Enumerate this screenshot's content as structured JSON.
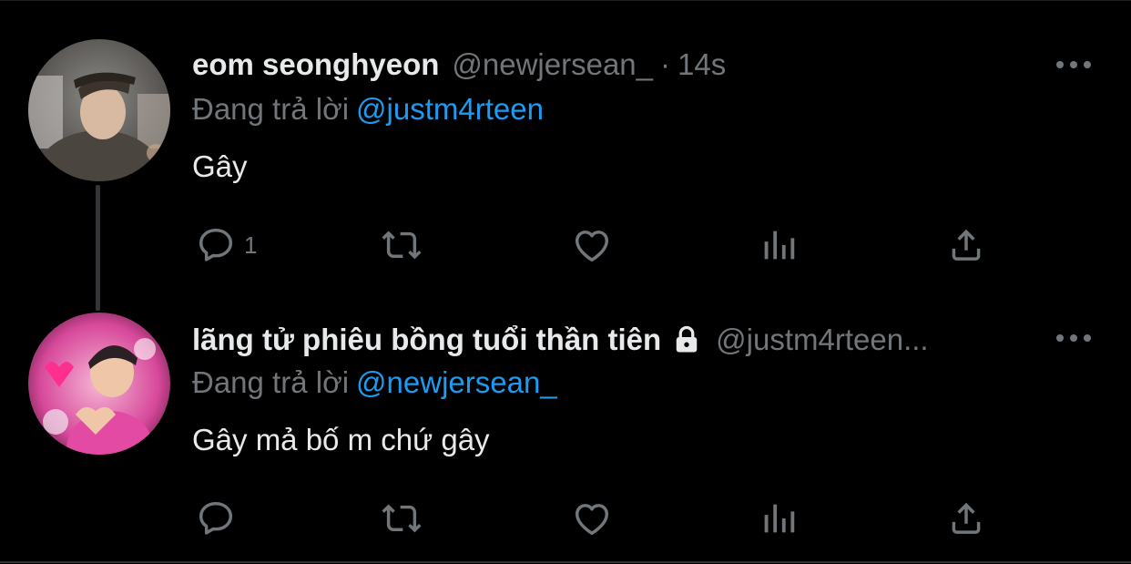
{
  "tweets": [
    {
      "display_name": "eom seonghyeon",
      "handle": "@newjersean_",
      "separator": "·",
      "time": "14s",
      "replying_label": "Đang trả lời",
      "replying_to": "@justm4rteen",
      "text": "Gây",
      "actions": {
        "reply_count": "1",
        "retweet_count": "",
        "like_count": ""
      }
    },
    {
      "display_name": "lãng tử phiêu bồng tuổi thần tiên",
      "protected": true,
      "handle": "@justm4rteen...",
      "replying_label": "Đang trả lời",
      "replying_to": "@newjersean_",
      "text": "Gây mả bố m chứ gây",
      "actions": {
        "reply_count": "",
        "retweet_count": "",
        "like_count": ""
      }
    }
  ],
  "colors": {
    "background": "#000000",
    "text_primary": "#e7e9ea",
    "text_secondary": "#71767b",
    "link": "#1d9bf0",
    "thread_line": "#333639"
  },
  "icons": {
    "more": "more-horizontal-icon",
    "reply": "reply-bubble-icon",
    "retweet": "retweet-icon",
    "like": "heart-icon",
    "views": "analytics-bars-icon",
    "share": "share-upload-icon",
    "lock": "lock-icon"
  }
}
